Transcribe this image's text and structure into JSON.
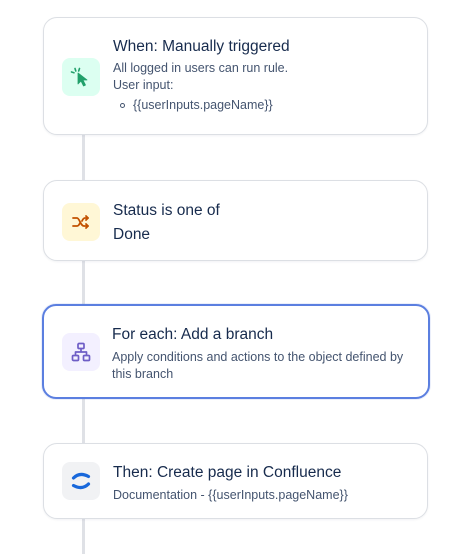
{
  "steps": [
    {
      "title": "When: Manually triggered",
      "description": "All logged in users can run rule.",
      "input_label": "User input:",
      "input_items": [
        "{{userInputs.pageName}}"
      ],
      "icon": "cursor-click-icon",
      "icon_color": "#22a06b",
      "icon_bg": "#dcfff1"
    },
    {
      "title": "Status is one of",
      "value": "Done",
      "icon": "shuffle-icon",
      "icon_color": "#c25100",
      "icon_bg": "#fff7d6"
    },
    {
      "title": "For each: Add a branch",
      "description": "Apply conditions and actions to the object defined by this branch",
      "icon": "branch-hierarchy-icon",
      "icon_color": "#6e5dc6",
      "icon_bg": "#f3f0ff",
      "selected": true
    },
    {
      "title": "Then: Create page in Confluence",
      "description": "Documentation - {{userInputs.pageName}}",
      "icon": "confluence-logo-icon",
      "icon_color": "#1868db",
      "icon_bg": "#f1f2f4"
    }
  ],
  "colors": {
    "selected_border": "#5b7fe0",
    "connector": "#dfe1e6",
    "text_primary": "#172b4d",
    "text_secondary": "#44546f"
  }
}
